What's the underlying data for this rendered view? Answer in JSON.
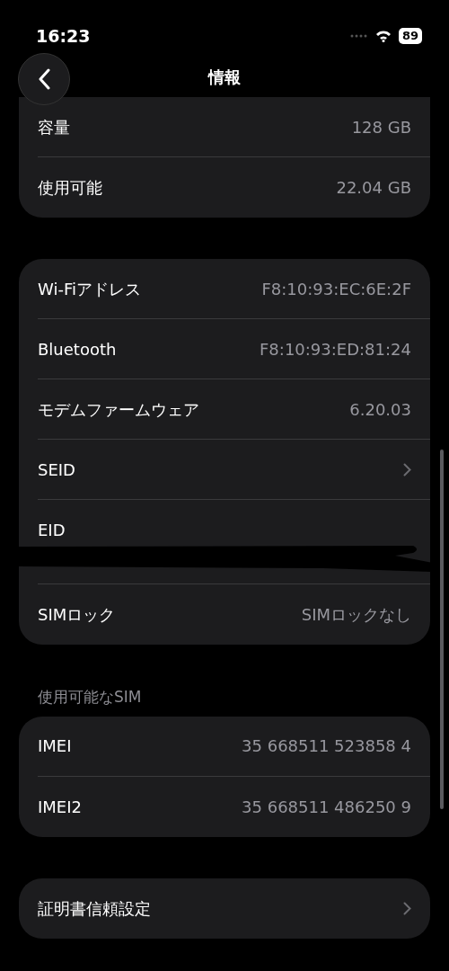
{
  "status_bar": {
    "time": "16:23",
    "battery": "89"
  },
  "nav": {
    "title": "情報"
  },
  "groups": [
    {
      "rows": [
        {
          "kind": "value",
          "label": "容量",
          "value": "128 GB"
        },
        {
          "kind": "value",
          "label": "使用可能",
          "value": "22.04 GB"
        }
      ]
    },
    {
      "rows": [
        {
          "kind": "value",
          "label": "Wi-Fiアドレス",
          "value": "F8:10:93:EC:6E:2F"
        },
        {
          "kind": "value",
          "label": "Bluetooth",
          "value": "F8:10:93:ED:81:24"
        },
        {
          "kind": "value",
          "label": "モデムファームウェア",
          "value": "6.20.03"
        },
        {
          "kind": "chevron",
          "label": "SEID"
        },
        {
          "kind": "redacted",
          "label": "EID"
        },
        {
          "kind": "value",
          "label": "SIMロック",
          "value": "SIMロックなし"
        }
      ]
    },
    {
      "header": "使用可能なSIM",
      "rows": [
        {
          "kind": "value",
          "label": "IMEI",
          "value": "35 668511 523858 4"
        },
        {
          "kind": "value",
          "label": "IMEI2",
          "value": "35 668511 486250 9"
        }
      ]
    },
    {
      "rows": [
        {
          "kind": "chevron",
          "label": "証明書信頼設定"
        }
      ]
    }
  ]
}
